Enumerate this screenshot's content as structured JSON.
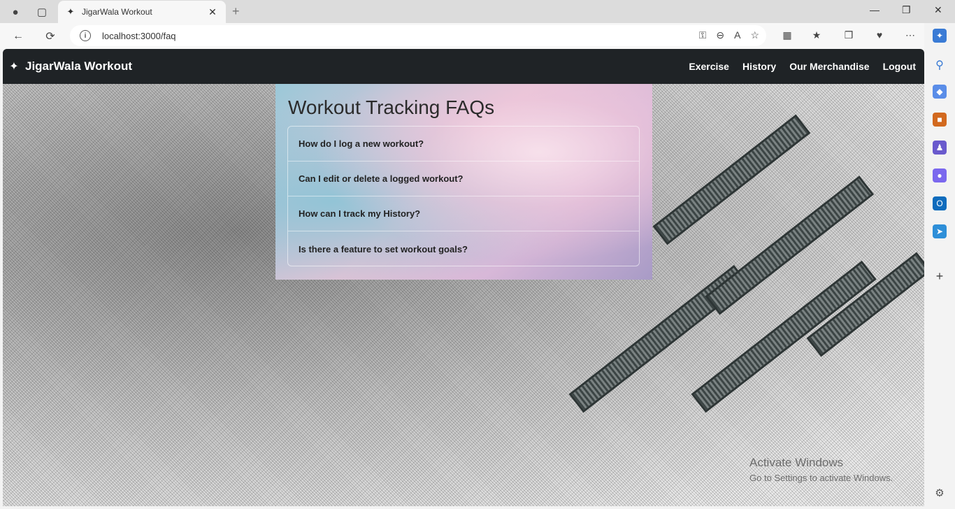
{
  "browser": {
    "tab_title": "JigarWala Workout",
    "url": "localhost:3000/faq"
  },
  "navbar": {
    "brand": "JigarWala Workout",
    "links": [
      "Exercise",
      "History",
      "Our Merchandise",
      "Logout"
    ]
  },
  "faq": {
    "title": "Workout Tracking FAQs",
    "questions": [
      "How do I log a new workout?",
      "Can I edit or delete a logged workout?",
      "How can I track my History?",
      "Is there a feature to set workout goals?"
    ]
  },
  "watermark": {
    "title": "Activate Windows",
    "subtitle": "Go to Settings to activate Windows."
  },
  "colors": {
    "navbar_bg": "#1f2326",
    "page_text": "#2b2b2b"
  }
}
